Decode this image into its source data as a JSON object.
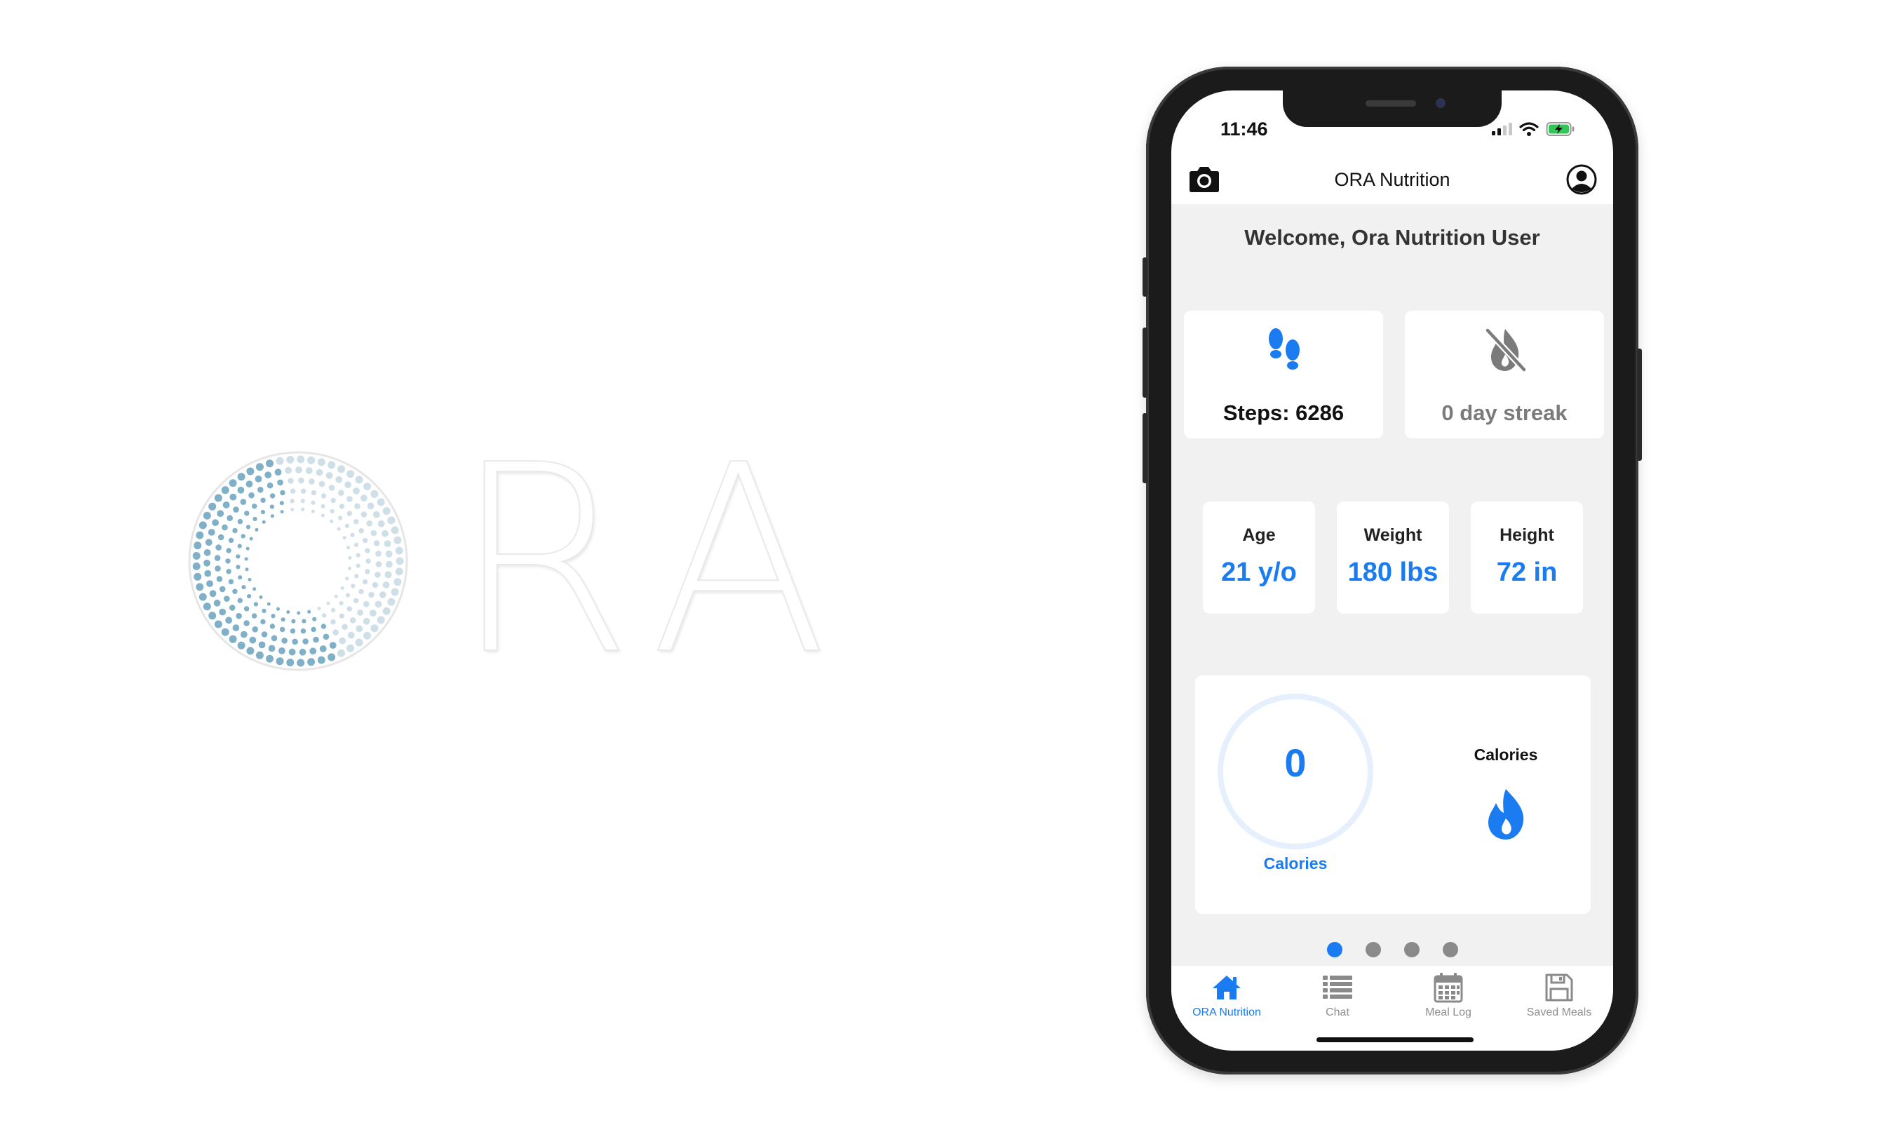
{
  "logo": {
    "text": "RA"
  },
  "status_bar": {
    "time": "11:46"
  },
  "app": {
    "title": "ORA Nutrition",
    "welcome": "Welcome, Ora Nutrition User",
    "steps": {
      "label": "Steps: 6286",
      "icon": "footsteps-icon"
    },
    "streak": {
      "label": "0 day streak",
      "icon": "flame-slash-icon"
    },
    "stats": [
      {
        "label": "Age",
        "value": "21 y/o"
      },
      {
        "label": "Weight",
        "value": "180 lbs"
      },
      {
        "label": "Height",
        "value": "72 in"
      }
    ],
    "calories": {
      "value": "0",
      "ring_label": "Calories",
      "side_label": "Calories",
      "progress": 0
    },
    "pager": {
      "count": 4,
      "active_index": 0
    },
    "tabs": [
      {
        "label": "ORA Nutrition",
        "icon": "home-icon",
        "active": true
      },
      {
        "label": "Chat",
        "icon": "list-icon",
        "active": false
      },
      {
        "label": "Meal Log",
        "icon": "calendar-icon",
        "active": false
      },
      {
        "label": "Saved Meals",
        "icon": "floppy-disk-icon",
        "active": false
      }
    ]
  },
  "colors": {
    "accent": "#1a7cf0",
    "inactive": "#8e8e93",
    "background": "#f1f1f1",
    "card": "#ffffff",
    "streak_gray": "#7b7b7b"
  }
}
